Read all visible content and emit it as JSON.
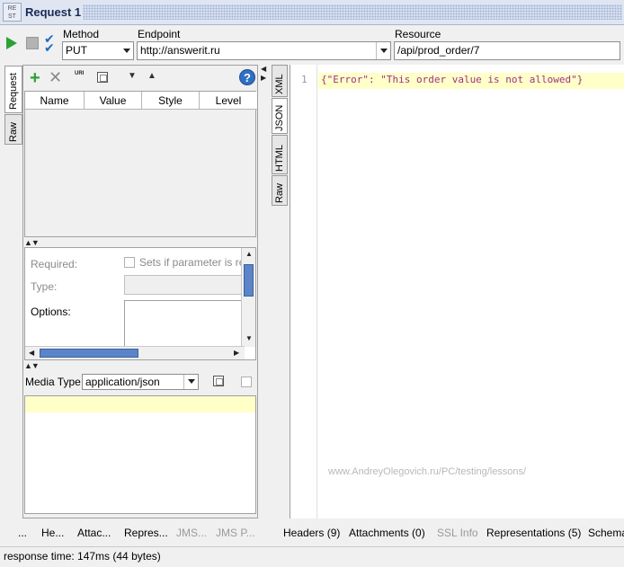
{
  "window": {
    "rest_icon": "RE ST",
    "title": "Request 1"
  },
  "toolbar": {
    "method_label": "Method",
    "method_value": "PUT",
    "endpoint_label": "Endpoint",
    "endpoint_value": "http://answerit.ru",
    "resource_label": "Resource",
    "resource_value": "/api/prod_order/7"
  },
  "left_tabs": {
    "request": "Request",
    "raw": "Raw"
  },
  "params": {
    "icon_uri": "URI",
    "help": "?",
    "columns": [
      "Name",
      "Value",
      "Style",
      "Level"
    ]
  },
  "properties": {
    "required_label": "Required:",
    "required_hint": "Sets if parameter is req",
    "type_label": "Type:",
    "options_label": "Options:"
  },
  "media": {
    "label": "Media Type",
    "value": "application/json"
  },
  "left_bottom_tabs": [
    {
      "label": "...",
      "disabled": false
    },
    {
      "label": "He...",
      "disabled": false
    },
    {
      "label": "Attac...",
      "disabled": false
    },
    {
      "label": "Repres...",
      "disabled": false
    },
    {
      "label": "JMS...",
      "disabled": true
    },
    {
      "label": "JMS P...",
      "disabled": true
    }
  ],
  "response_tabs": [
    "XML",
    "JSON",
    "HTML",
    "Raw"
  ],
  "response": {
    "line_number": "1",
    "content": "{\"Error\": \"This order value is not allowed\"}",
    "watermark": "www.AndreyOlegovich.ru/PC/testing/lessons/"
  },
  "right_bottom_tabs": [
    {
      "label": "Headers (9)",
      "disabled": false
    },
    {
      "label": "Attachments (0)",
      "disabled": false
    },
    {
      "label": "SSL Info",
      "disabled": true
    },
    {
      "label": "Representations (5)",
      "disabled": false
    },
    {
      "label": "Schema",
      "disabled": false
    }
  ],
  "status": {
    "text": "response time: 147ms (44 bytes)"
  },
  "colors": {
    "accent_green": "#2aa234",
    "json_text": "#a0308a",
    "highlight": "#ffffc8",
    "scroll_thumb": "#5b85c8"
  }
}
